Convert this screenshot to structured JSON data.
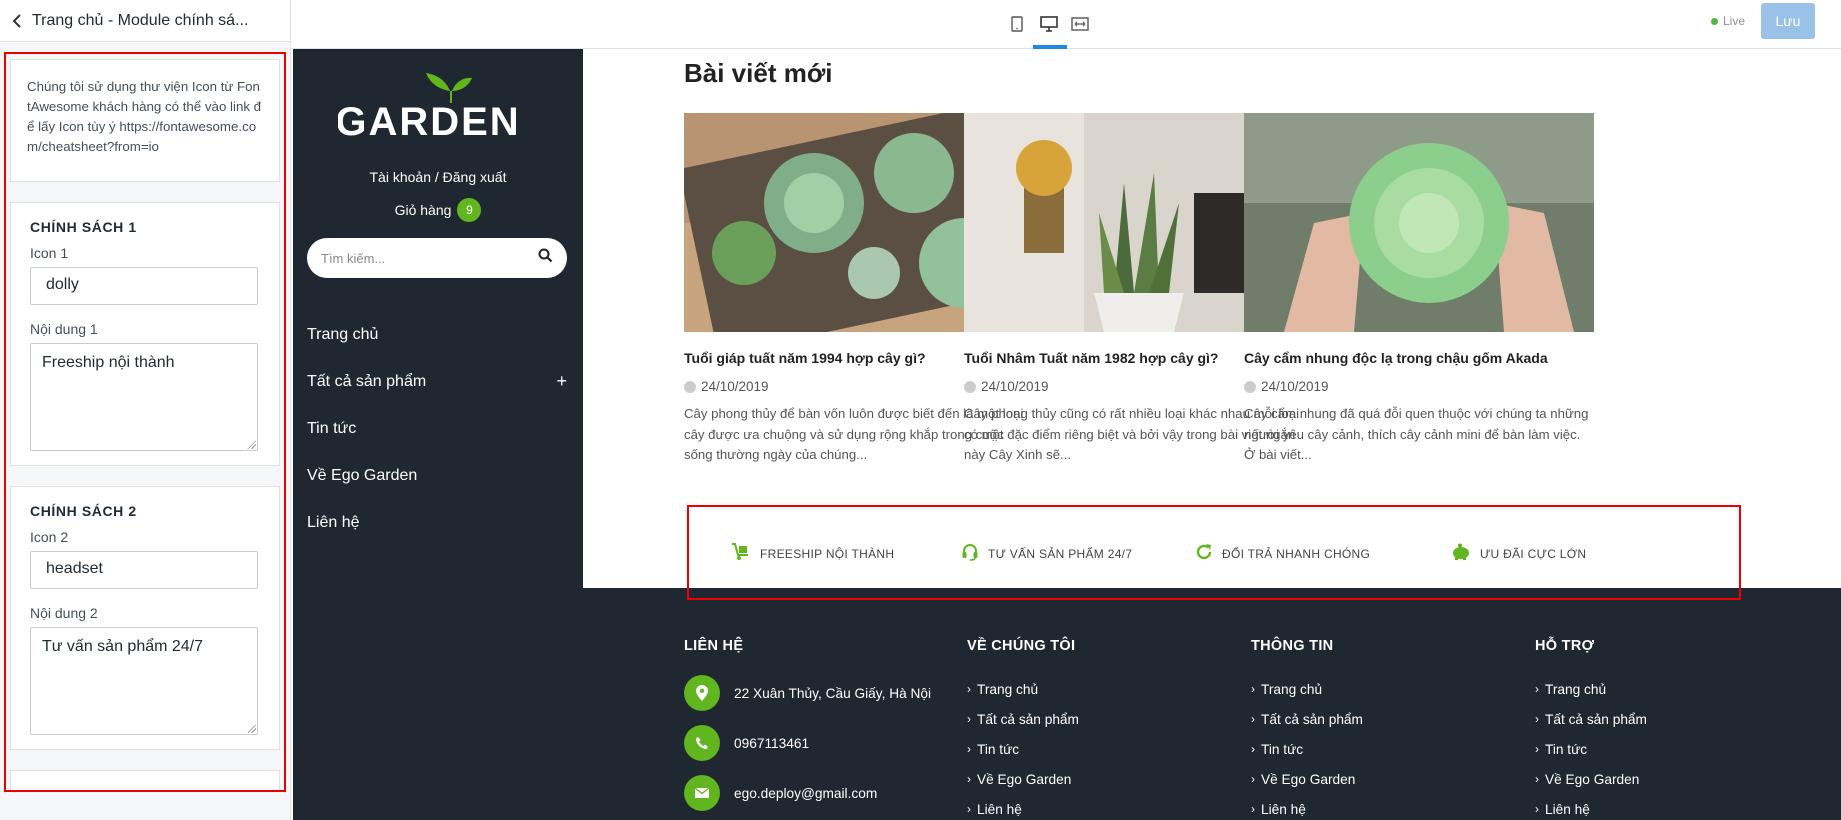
{
  "panel": {
    "title": "Trang chủ - Module chính sá...",
    "note": "Chúng tôi sử dụng thư viện Icon từ FontAwesome khách hàng có thể vào link để lấy Icon tùy ý https://fontawesome.com/cheatsheet?from=io",
    "sections": [
      {
        "title": "CHÍNH SÁCH 1",
        "icon_label": "Icon 1",
        "icon_value": "dolly",
        "content_label": "Nội dung 1",
        "content_value": "Freeship nội thành"
      },
      {
        "title": "CHÍNH SÁCH 2",
        "icon_label": "Icon 2",
        "icon_value": "headset",
        "content_label": "Nội dung 2",
        "content_value": "Tư vấn sản phẩm 24/7"
      }
    ]
  },
  "toolbar": {
    "live_label": "Live",
    "save_label": "Lưu",
    "accent": "#1e88e5"
  },
  "site": {
    "logo_text": "GARDEN",
    "account": "Tài khoản / Đăng xuất",
    "cart_label": "Giỏ hàng",
    "cart_count": "9",
    "search_placeholder": "Tìm kiếm...",
    "menu": [
      "Trang chủ",
      "Tất cả sản phẩm",
      "Tin tức",
      "Về Ego Garden",
      "Liên hệ"
    ],
    "menu_plus": "+",
    "brand_color": "#61b51f",
    "dark_color": "#1f2730"
  },
  "blog": {
    "heading": "Bài viết mới",
    "posts": [
      {
        "title": "Tuổi giáp tuất năm 1994 hợp cây gì?",
        "date": "24/10/2019",
        "excerpt": "Cây phong thủy để bàn vốn luôn được biết đến là một loại cây được ưa chuộng và sử dụng rộng khắp trong cuộc sống thường ngày của chúng..."
      },
      {
        "title": "Tuổi Nhâm Tuất năm 1982 hợp cây gì?",
        "date": "24/10/2019",
        "excerpt": "Cây phong thủy cũng có rất nhiều loại khác nhau mỗi loại có một đặc điểm riêng biệt và bởi vậy trong bài viết ngắn này Cây Xinh sẽ..."
      },
      {
        "title": "Cây cẩm nhung độc lạ trong chậu gốm Akada",
        "date": "24/10/2019",
        "excerpt": "Cây cẩm nhung đã quá đỗi quen thuộc với chúng ta những người yêu cây cảnh, thích cây cảnh mini để bàn làm việc. Ở bài viết..."
      }
    ]
  },
  "policies": [
    {
      "label": "FREESHIP NỘI THÀNH",
      "icon": "dolly-icon"
    },
    {
      "label": "TƯ VẤN SẢN PHẨM 24/7",
      "icon": "headset-icon"
    },
    {
      "label": "ĐỔI TRẢ NHANH CHÓNG",
      "icon": "redo-icon"
    },
    {
      "label": "ƯU ĐÃI CỰC LỚN",
      "icon": "piggy-bank-icon"
    }
  ],
  "footer": {
    "contact_heading": "LIÊN HỆ",
    "address": "22 Xuân Thủy, Cầu Giấy, Hà Nội",
    "phone": "0967113461",
    "email": "ego.deploy@gmail.com",
    "columns": [
      {
        "heading": "VỀ CHÚNG TÔI",
        "links": [
          "Trang chủ",
          "Tất cả sản phẩm",
          "Tin tức",
          "Về Ego Garden",
          "Liên hệ"
        ]
      },
      {
        "heading": "THÔNG TIN",
        "links": [
          "Trang chủ",
          "Tất cả sản phẩm",
          "Tin tức",
          "Về Ego Garden",
          "Liên hệ"
        ]
      },
      {
        "heading": "HỖ TRỢ",
        "links": [
          "Trang chủ",
          "Tất cả sản phẩm",
          "Tin tức",
          "Về Ego Garden",
          "Liên hệ"
        ]
      }
    ],
    "chevron": "›"
  }
}
